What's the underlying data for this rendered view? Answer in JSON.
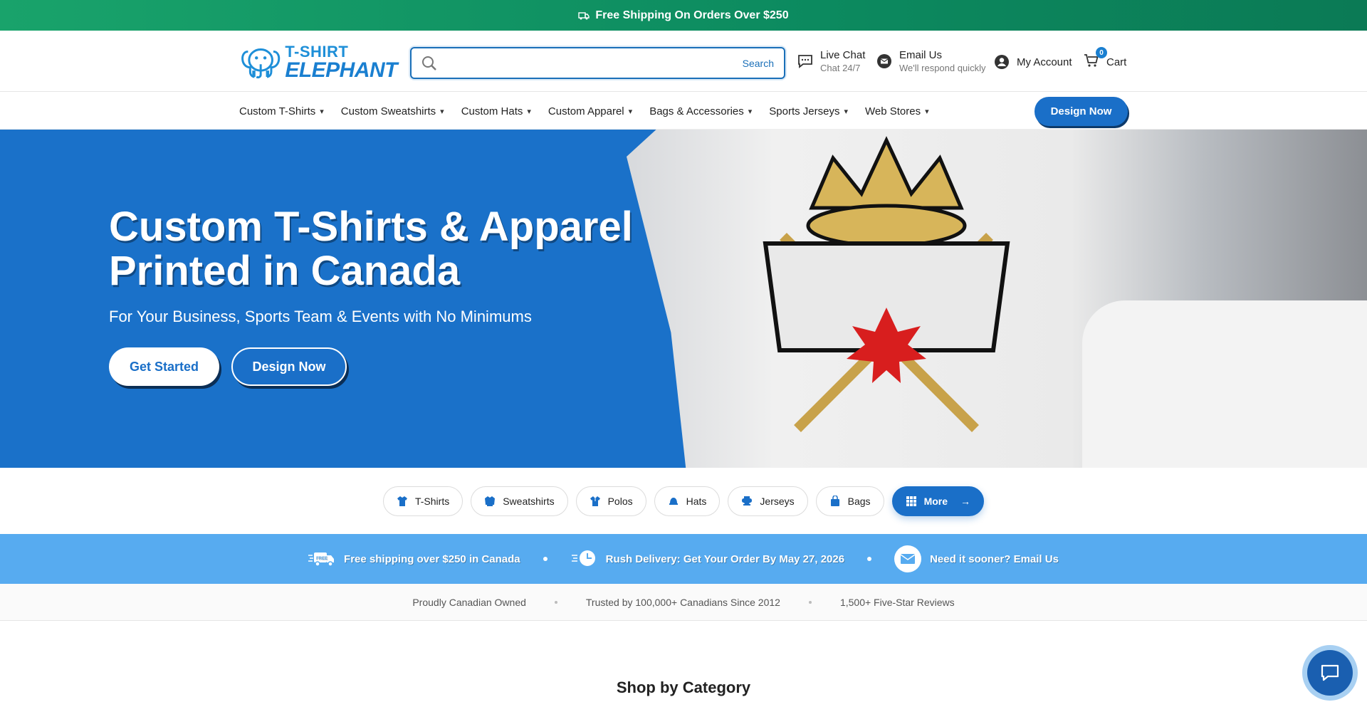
{
  "topbar": {
    "text": "Free Shipping On Orders Over $250",
    "icon": "truck-icon"
  },
  "header": {
    "logo_line1": "T-SHIRT",
    "logo_line2": "ELEPHANT",
    "search": {
      "value": "",
      "placeholder": "",
      "button": "Search"
    },
    "live_chat": {
      "label": "Live Chat",
      "sub": "Chat 24/7"
    },
    "email": {
      "label": "Email Us",
      "sub": "We'll respond quickly"
    },
    "account": "My Account",
    "cart": {
      "label": "Cart",
      "count": "0"
    }
  },
  "nav": {
    "items": [
      "Custom T-Shirts",
      "Custom Sweatshirts",
      "Custom Hats",
      "Custom Apparel",
      "Bags & Accessories",
      "Sports Jerseys",
      "Web Stores"
    ],
    "cta": "Design Now"
  },
  "hero": {
    "title_line1": "Custom T-Shirts & Apparel",
    "title_line2": "Printed in Canada",
    "subtitle": "For Your Business, Sports Team & Events with No Minimums",
    "btn_start": "Get Started",
    "btn_design": "Design Now"
  },
  "chips": [
    {
      "label": "T-Shirts",
      "icon": "tshirt-icon"
    },
    {
      "label": "Sweatshirts",
      "icon": "sweatshirt-icon"
    },
    {
      "label": "Polos",
      "icon": "polo-icon"
    },
    {
      "label": "Hats",
      "icon": "hat-icon"
    },
    {
      "label": "Jerseys",
      "icon": "jersey-icon"
    },
    {
      "label": "Bags",
      "icon": "bag-icon"
    },
    {
      "label": "More",
      "arrow": "→",
      "icon": "grid-icon"
    }
  ],
  "info": {
    "shipping": "Free shipping over $250 in Canada",
    "rush": "Rush Delivery: Get Your Order By May 27, 2026",
    "email": "Need it sooner? Email Us",
    "free_badge": "FREE"
  },
  "trust": [
    "Proudly Canadian Owned",
    "Trusted by 100,000+ Canadians Since 2012",
    "1,500+ Five-Star Reviews"
  ],
  "shop_title": "Shop by Category",
  "colors": {
    "brand_blue": "#1a6fc8",
    "green": "#0c8a5f",
    "info_blue": "#57abf0"
  }
}
